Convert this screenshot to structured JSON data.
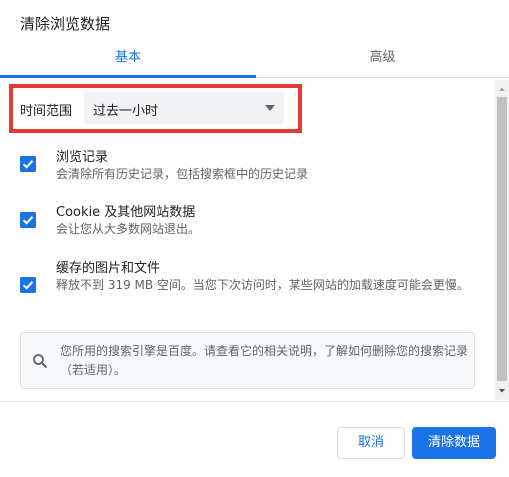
{
  "dialog": {
    "title": "清除浏览数据"
  },
  "tabs": [
    {
      "label": "基本",
      "active": true
    },
    {
      "label": "高级",
      "active": false
    }
  ],
  "time_range": {
    "label": "时间范围",
    "selected": "过去一小时"
  },
  "options": [
    {
      "title": "浏览记录",
      "description": "会清除所有历史记录，包括搜索框中的历史记录",
      "checked": true
    },
    {
      "title": "Cookie 及其他网站数据",
      "description": "会让您从大多数网站退出。",
      "checked": true
    },
    {
      "title": "缓存的图片和文件",
      "description": "释放不到 319 MB 空间。当您下次访问时，某些网站的加载速度可能会更慢。",
      "checked": true
    }
  ],
  "info": {
    "icon": "search-icon",
    "text": "您所用的搜索引擎是百度。请查看它的相关说明，了解如何删除您的搜索记录（若适用）。"
  },
  "buttons": {
    "cancel": "取消",
    "clear": "清除数据"
  },
  "colors": {
    "accent": "#1a73e8",
    "highlight": "#e53935"
  }
}
